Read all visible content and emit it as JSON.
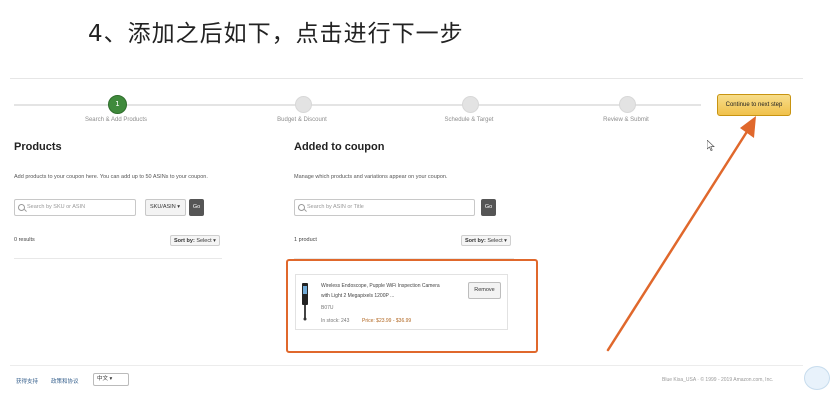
{
  "heading": "4、添加之后如下，点击进行下一步",
  "stepper": {
    "steps": [
      {
        "label": "Search & Add Products",
        "marker": "1",
        "active": true
      },
      {
        "label": "Budget & Discount",
        "marker": "",
        "active": false
      },
      {
        "label": "Schedule & Target",
        "marker": "",
        "active": false
      },
      {
        "label": "Review & Submit",
        "marker": "",
        "active": false
      }
    ],
    "continue_label": "Continue to next step"
  },
  "products": {
    "title": "Products",
    "description": "Add products to your coupon here. You can add up to 50 ASINs to your coupon.",
    "search_placeholder": "Search by SKU or ASIN",
    "search_type": "SKU/ASIN",
    "go_label": "Go",
    "results": "0 results",
    "sort_label": "Sort by:",
    "sort_value": "Select"
  },
  "added": {
    "title": "Added to coupon",
    "description": "Manage which products and variations appear on your coupon.",
    "search_placeholder": "Search by ASIN or Title",
    "go_label": "Go",
    "count": "1 product",
    "sort_label": "Sort by:",
    "sort_value": "Select",
    "item": {
      "title_line1": "Wireless Endoscope, Pupple WiFi Inspection Camera",
      "title_line2": "with Light 2 Megapixels 1200P ...",
      "asin": "B07U",
      "stock": "In stock: 243",
      "price": "Price: $23.99 - $36.99",
      "remove_label": "Remove"
    }
  },
  "footer": {
    "link_help": "获得支持",
    "link_privacy": "政策和协议",
    "language": "中文",
    "right_text": "Blue Kisa_USA  ·  © 1999 - 2019 Amazon.com, Inc."
  },
  "colors": {
    "accent_orange": "#e0682c",
    "button_yellow": "#f0c14b",
    "step_green": "#3f8a3c"
  }
}
